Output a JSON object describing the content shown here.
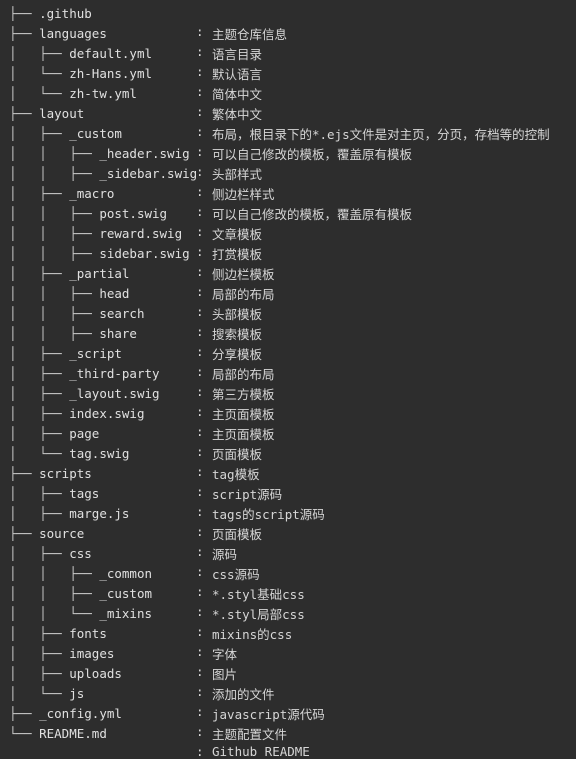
{
  "theme": {
    "background": "#2d2d2d",
    "branch_color": "#c8c8c8",
    "name_color": "#e0e0e0",
    "desc_color": "#d6d6d6",
    "separator": ":"
  },
  "tree": {
    "rows": [
      {
        "branch": "├── ",
        "name": ".github",
        "desc": "主题仓库信息"
      },
      {
        "branch": "├── ",
        "name": "languages",
        "desc": "语言目录"
      },
      {
        "branch": "│   ├── ",
        "name": "default.yml",
        "desc": "默认语言"
      },
      {
        "branch": "│   └── ",
        "name": "zh-Hans.yml",
        "desc": "简体中文"
      },
      {
        "branch": "│   └── ",
        "name": "zh-tw.yml",
        "desc": "繁体中文"
      },
      {
        "branch": "├── ",
        "name": "layout",
        "desc": "布局，根目录下的*.ejs文件是对主页，分页，存档等的控制"
      },
      {
        "branch": "│   ├── ",
        "name": "_custom",
        "desc": "可以自己修改的模板，覆盖原有模板"
      },
      {
        "branch": "│   │   ├── ",
        "name": "_header.swig",
        "desc": "头部样式"
      },
      {
        "branch": "│   │   ├── ",
        "name": "_sidebar.swig",
        "desc": "侧边栏样式"
      },
      {
        "branch": "│   ├── ",
        "name": "_macro",
        "desc": "可以自己修改的模板，覆盖原有模板"
      },
      {
        "branch": "│   │   ├── ",
        "name": "post.swig",
        "desc": "文章模板"
      },
      {
        "branch": "│   │   ├── ",
        "name": "reward.swig",
        "desc": "打赏模板"
      },
      {
        "branch": "│   │   ├── ",
        "name": "sidebar.swig",
        "desc": "侧边栏模板"
      },
      {
        "branch": "│   ├── ",
        "name": "_partial",
        "desc": "局部的布局"
      },
      {
        "branch": "│   │   ├── ",
        "name": "head",
        "desc": "头部模板"
      },
      {
        "branch": "│   │   ├── ",
        "name": "search",
        "desc": "搜索模板"
      },
      {
        "branch": "│   │   ├── ",
        "name": "share",
        "desc": "分享模板"
      },
      {
        "branch": "│   ├── ",
        "name": "_script",
        "desc": "局部的布局"
      },
      {
        "branch": "│   ├── ",
        "name": "_third-party",
        "desc": "第三方模板"
      },
      {
        "branch": "│   ├── ",
        "name": "_layout.swig",
        "desc": "主页面模板"
      },
      {
        "branch": "│   ├── ",
        "name": "index.swig",
        "desc": "主页面模板"
      },
      {
        "branch": "│   ├── ",
        "name": "page",
        "desc": "页面模板"
      },
      {
        "branch": "│   └── ",
        "name": "tag.swig",
        "desc": "tag模板"
      },
      {
        "branch": "├── ",
        "name": "scripts",
        "desc": "script源码"
      },
      {
        "branch": "│   ├── ",
        "name": "tags",
        "desc": "tags的script源码"
      },
      {
        "branch": "│   ├── ",
        "name": "marge.js",
        "desc": "页面模板"
      },
      {
        "branch": "├── ",
        "name": "source",
        "desc": "源码"
      },
      {
        "branch": "│   ├── ",
        "name": "css",
        "desc": "css源码"
      },
      {
        "branch": "│   │   ├── ",
        "name": "_common",
        "desc": "*.styl基础css"
      },
      {
        "branch": "│   │   ├── ",
        "name": "_custom",
        "desc": "*.styl局部css"
      },
      {
        "branch": "│   │   └── ",
        "name": "_mixins",
        "desc": "mixins的css"
      },
      {
        "branch": "│   ├── ",
        "name": "fonts",
        "desc": "字体"
      },
      {
        "branch": "│   ├── ",
        "name": "images",
        "desc": "图片"
      },
      {
        "branch": "│   ├── ",
        "name": "uploads",
        "desc": "添加的文件"
      },
      {
        "branch": "│   └── ",
        "name": "js",
        "desc": "javascript源代码"
      },
      {
        "branch": "├── ",
        "name": "_config.yml",
        "desc": "主题配置文件"
      },
      {
        "branch": "└── ",
        "name": "README.md",
        "desc": "Github README"
      }
    ]
  }
}
